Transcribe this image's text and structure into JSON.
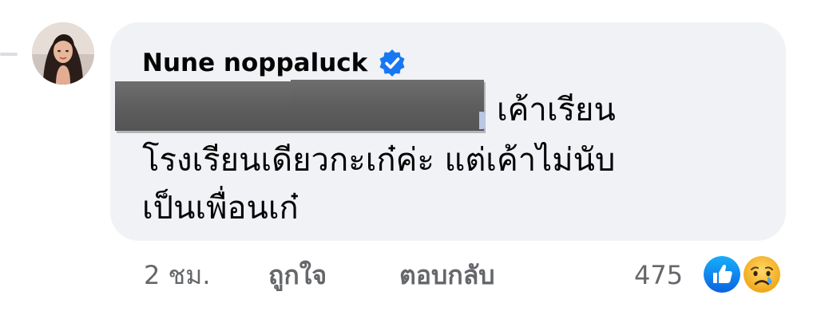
{
  "comment": {
    "author": "Nune noppaluck",
    "verified": true,
    "text_lines": [
      "เค้าเรียน",
      "โรงเรียนเดียวกะเก๋ค่ะ แต่เค้าไม่นับ",
      "เป็นเพื่อนเก๋"
    ],
    "redacted_mention": true
  },
  "meta": {
    "time": "2 ชม.",
    "like_label": "ถูกใจ",
    "reply_label": "ตอบกลับ",
    "reaction_count": "475"
  },
  "reactions": [
    "like-icon",
    "sad-icon"
  ],
  "colors": {
    "bubble": "#f0f2f5",
    "verified": "#1877f2",
    "meta_text": "#65676b",
    "like_reaction": "#1877f2",
    "sad_reaction": "#f7b125"
  }
}
